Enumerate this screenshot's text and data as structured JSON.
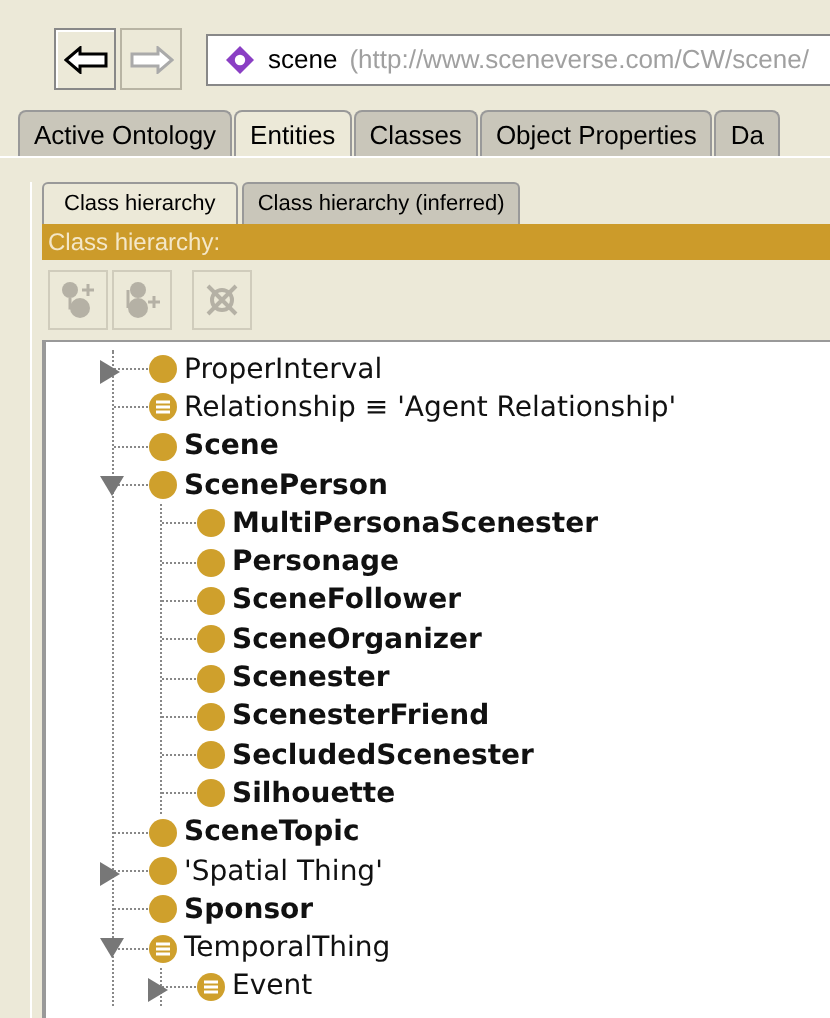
{
  "nav": [
    {
      "kind": "back",
      "disabled": false
    },
    {
      "kind": "forward",
      "disabled": true
    }
  ],
  "address": {
    "name": "scene",
    "iri": "(http://www.sceneverse.com/CW/scene/"
  },
  "tabs": [
    {
      "label": "Active Ontology",
      "selected": false
    },
    {
      "label": "Entities",
      "selected": true
    },
    {
      "label": "Classes",
      "selected": false
    },
    {
      "label": "Object Properties",
      "selected": false
    },
    {
      "label": "Da",
      "selected": false
    }
  ],
  "subtabs": [
    {
      "label": "Class hierarchy",
      "selected": true
    },
    {
      "label": "Class hierarchy (inferred)",
      "selected": false
    }
  ],
  "panel_title": "Class hierarchy:",
  "toolbar": [
    {
      "kind": "add-subclass",
      "disabled": true
    },
    {
      "kind": "add-sibling",
      "disabled": true
    },
    {
      "kind": "delete",
      "disabled": true
    }
  ],
  "tree": [
    {
      "label": "ProperInterval",
      "kind": "class",
      "bold": false,
      "expanded": false
    },
    {
      "label": "Relationship ≡ 'Agent Relationship'",
      "kind": "defined",
      "bold": false
    },
    {
      "label": "Scene",
      "kind": "class",
      "bold": true
    },
    {
      "label": "ScenePerson",
      "kind": "class",
      "bold": true,
      "expanded": true,
      "children": [
        {
          "label": "MultiPersonaScenester",
          "kind": "class",
          "bold": true
        },
        {
          "label": "Personage",
          "kind": "class",
          "bold": true
        },
        {
          "label": "SceneFollower",
          "kind": "class",
          "bold": true
        },
        {
          "label": "SceneOrganizer",
          "kind": "class",
          "bold": true
        },
        {
          "label": "Scenester",
          "kind": "class",
          "bold": true
        },
        {
          "label": "ScenesterFriend",
          "kind": "class",
          "bold": true
        },
        {
          "label": "SecludedScenester",
          "kind": "class",
          "bold": true
        },
        {
          "label": "Silhouette",
          "kind": "class",
          "bold": true
        }
      ]
    },
    {
      "label": "SceneTopic",
      "kind": "class",
      "bold": true
    },
    {
      "label": "'Spatial Thing'",
      "kind": "class",
      "bold": false,
      "expanded": false
    },
    {
      "label": "Sponsor",
      "kind": "class",
      "bold": true
    },
    {
      "label": "TemporalThing",
      "kind": "defined",
      "bold": false,
      "expanded": true,
      "children": [
        {
          "label": "Event",
          "kind": "defined",
          "bold": false,
          "expanded": false
        }
      ]
    }
  ]
}
